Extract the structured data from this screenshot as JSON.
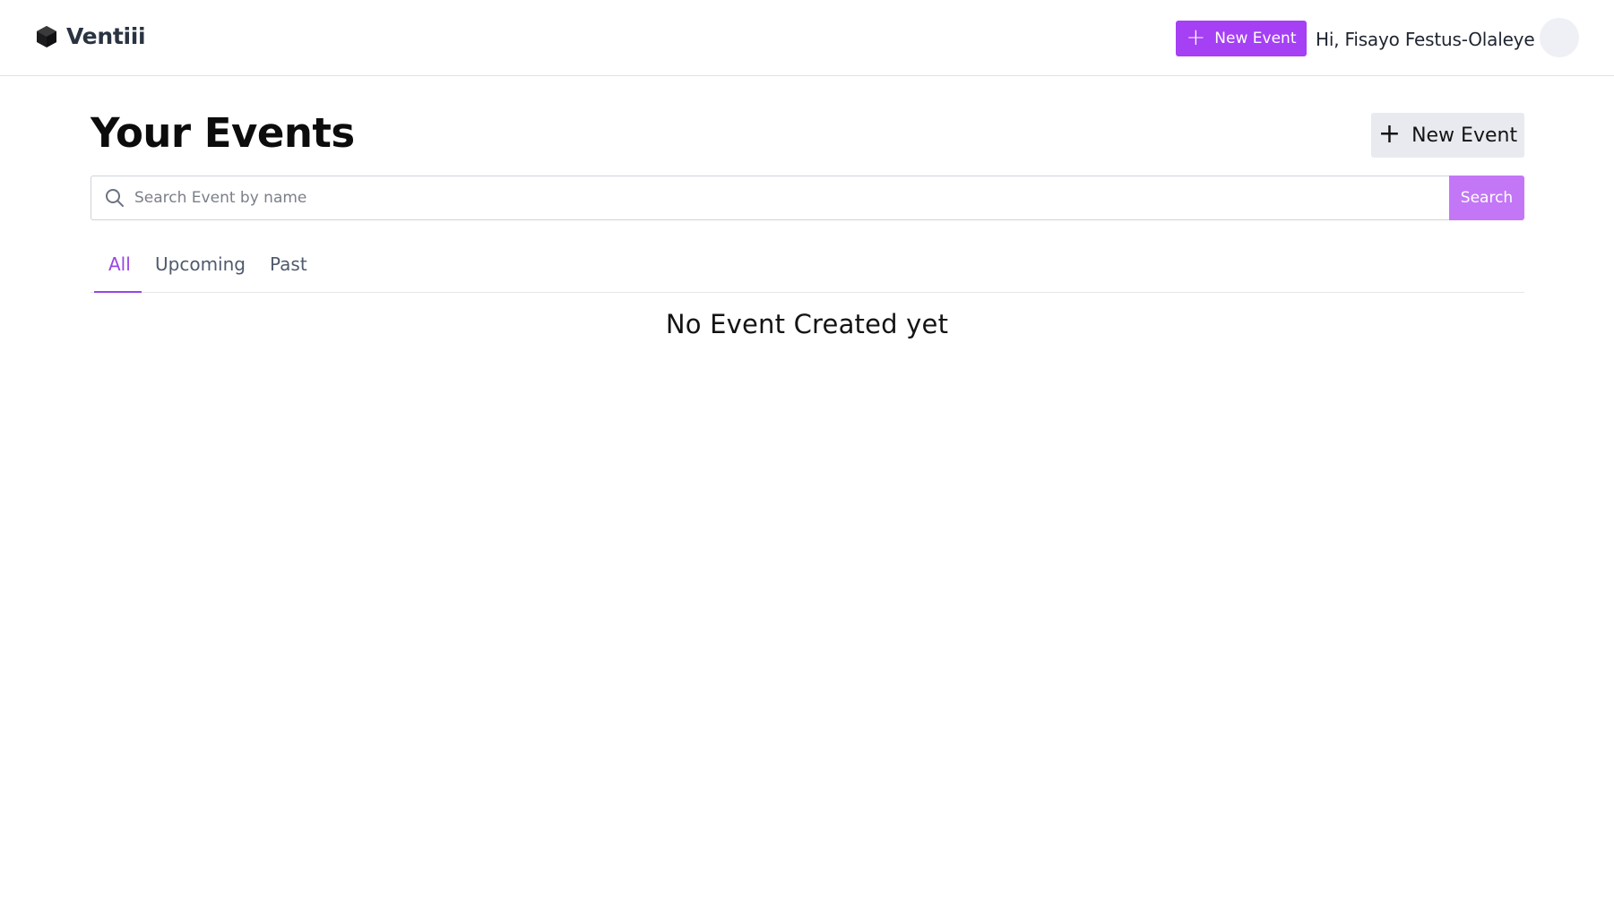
{
  "brand": {
    "name": "Ventiii",
    "icon": "cube-icon"
  },
  "header": {
    "new_event_label": "New Event",
    "greeting": "Hi, Fisayo Festus-Olaleye",
    "accent_color": "#a540f5"
  },
  "main": {
    "title": "Your Events",
    "new_event_label": "New Event",
    "search": {
      "placeholder": "Search Event by name",
      "button_label": "Search"
    },
    "tabs": [
      {
        "label": "All",
        "active": true
      },
      {
        "label": "Upcoming",
        "active": false
      },
      {
        "label": "Past",
        "active": false
      }
    ],
    "empty_message": "No Event Created yet"
  }
}
